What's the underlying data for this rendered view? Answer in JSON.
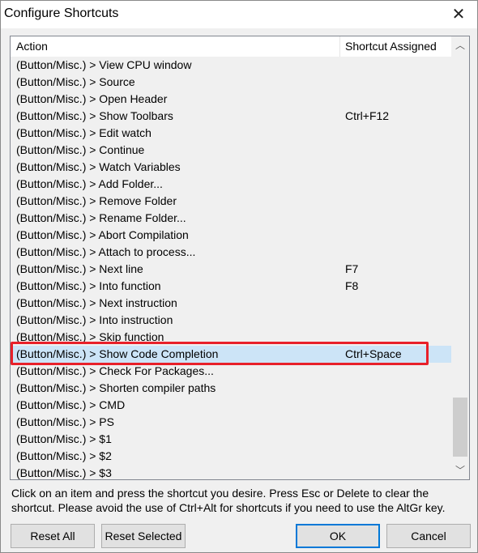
{
  "window": {
    "title": "Configure Shortcuts",
    "close_icon": "close-icon"
  },
  "table": {
    "headers": {
      "action": "Action",
      "shortcut": "Shortcut Assigned"
    },
    "rows": [
      {
        "action": "(Button/Misc.) > View CPU window",
        "shortcut": ""
      },
      {
        "action": "(Button/Misc.) > Source",
        "shortcut": ""
      },
      {
        "action": "(Button/Misc.) > Open Header",
        "shortcut": ""
      },
      {
        "action": "(Button/Misc.) > Show Toolbars",
        "shortcut": "Ctrl+F12"
      },
      {
        "action": "(Button/Misc.) > Edit watch",
        "shortcut": ""
      },
      {
        "action": "(Button/Misc.) > Continue",
        "shortcut": ""
      },
      {
        "action": "(Button/Misc.) > Watch Variables",
        "shortcut": ""
      },
      {
        "action": "(Button/Misc.) > Add Folder...",
        "shortcut": ""
      },
      {
        "action": "(Button/Misc.) > Remove Folder",
        "shortcut": ""
      },
      {
        "action": "(Button/Misc.) > Rename Folder...",
        "shortcut": ""
      },
      {
        "action": "(Button/Misc.) > Abort Compilation",
        "shortcut": ""
      },
      {
        "action": "(Button/Misc.) > Attach to process...",
        "shortcut": ""
      },
      {
        "action": "(Button/Misc.) > Next line",
        "shortcut": "F7"
      },
      {
        "action": "(Button/Misc.) > Into function",
        "shortcut": "F8"
      },
      {
        "action": "(Button/Misc.) > Next instruction",
        "shortcut": ""
      },
      {
        "action": "(Button/Misc.) > Into instruction",
        "shortcut": ""
      },
      {
        "action": "(Button/Misc.) > Skip function",
        "shortcut": ""
      },
      {
        "action": "(Button/Misc.) > Show Code Completion",
        "shortcut": "Ctrl+Space",
        "selected": true
      },
      {
        "action": "(Button/Misc.) > Check For Packages...",
        "shortcut": ""
      },
      {
        "action": "(Button/Misc.) > Shorten compiler paths",
        "shortcut": ""
      },
      {
        "action": "(Button/Misc.) > CMD",
        "shortcut": ""
      },
      {
        "action": "(Button/Misc.) > PS",
        "shortcut": ""
      },
      {
        "action": "(Button/Misc.) > $1",
        "shortcut": ""
      },
      {
        "action": "(Button/Misc.) > $2",
        "shortcut": ""
      },
      {
        "action": "(Button/Misc.) > $3",
        "shortcut": ""
      }
    ],
    "selection_color": "#cce4f7",
    "highlight_box_color": "#e8202a",
    "scroll_position_percent": 88
  },
  "help_text": "Click on an item and press the shortcut you desire. Press Esc or Delete to clear the shortcut. Please avoid the use of Ctrl+Alt for shortcuts if you need to use the AltGr key.",
  "buttons": {
    "reset_all": "Reset All",
    "reset_selected": "Reset Selected",
    "ok": "OK",
    "cancel": "Cancel"
  }
}
